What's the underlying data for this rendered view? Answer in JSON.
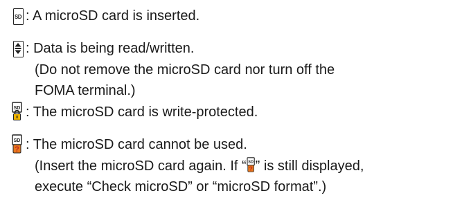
{
  "items": [
    {
      "icon": "sd-card-inserted-icon",
      "lines": [
        ": A microSD card is inserted."
      ]
    },
    {
      "icon": "sd-read-write-icon",
      "lines": [
        ": Data is being read/written.",
        "(Do not remove the microSD card nor turn off the",
        "FOMA terminal.)"
      ]
    },
    {
      "icon": "sd-write-protected-icon",
      "lines": [
        ": The microSD card is write-protected."
      ]
    },
    {
      "icon": "sd-unusable-icon",
      "lines": [
        ": The microSD card cannot be used.",
        "(Insert the microSD card again. If “",
        "” is still displayed,",
        "execute “Check microSD” or “microSD format”.)"
      ]
    }
  ],
  "icon_text": {
    "sd": "SD"
  },
  "colors": {
    "text": "#1a1a1a",
    "icon_outline": "#222222",
    "lock_fill": "#f0b400",
    "question_fill": "#e8781e",
    "question_mark": "#c0281e"
  }
}
